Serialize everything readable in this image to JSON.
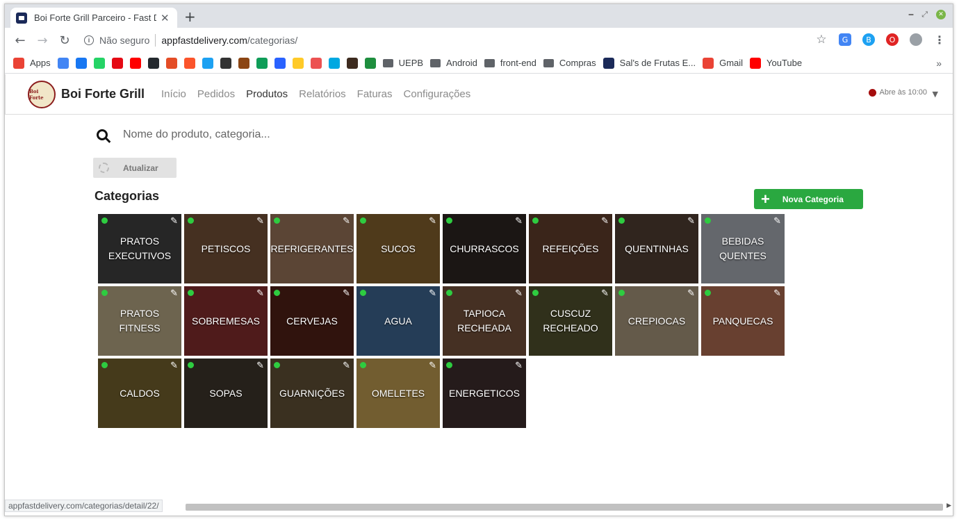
{
  "browser": {
    "tab_title": "Boi Forte Grill Parceiro - Fast De",
    "new_tab": "+",
    "address": {
      "security_label": "Não seguro",
      "host": "appfastdelivery.com",
      "path": "/categorias/"
    },
    "bookmarks": [
      {
        "label": "Apps",
        "icon": "apps-grid-icon",
        "color": "#ea4335"
      },
      {
        "label": "",
        "icon": "gcal-icon",
        "color": "#4285f4"
      },
      {
        "label": "",
        "icon": "facebook-icon",
        "color": "#1877f2"
      },
      {
        "label": "",
        "icon": "whatsapp-icon",
        "color": "#25d366"
      },
      {
        "label": "",
        "icon": "netflix-icon",
        "color": "#e50914"
      },
      {
        "label": "",
        "icon": "youtube-icon",
        "color": "#ff0000"
      },
      {
        "label": "",
        "icon": "github-icon",
        "color": "#24292e"
      },
      {
        "label": "",
        "icon": "ext-icon",
        "color": "#e44d26"
      },
      {
        "label": "",
        "icon": "brave-icon",
        "color": "#fb542b"
      },
      {
        "label": "",
        "icon": "twitter-icon",
        "color": "#1da1f2"
      },
      {
        "label": "",
        "icon": "trello-icon",
        "color": "#333333"
      },
      {
        "label": "",
        "icon": "book-icon",
        "color": "#8b4513"
      },
      {
        "label": "",
        "icon": "drive-icon",
        "color": "#0f9d58"
      },
      {
        "label": "",
        "icon": "ap-icon",
        "color": "#2962ff"
      },
      {
        "label": "",
        "icon": "firebase-icon",
        "color": "#ffca28"
      },
      {
        "label": "",
        "icon": "udemy-icon",
        "color": "#ec5252"
      },
      {
        "label": "",
        "icon": "u-icon",
        "color": "#00a8e1"
      },
      {
        "label": "",
        "icon": "k-icon",
        "color": "#3d2b1f"
      },
      {
        "label": "",
        "icon": "classroom-icon",
        "color": "#1e8e3e"
      }
    ],
    "bookmark_folders": [
      "UEPB",
      "Android",
      "front-end",
      "Compras"
    ],
    "bookmark_links": [
      {
        "label": "Sal's de Frutas E...",
        "color": "#1b2a59"
      },
      {
        "label": "Gmail",
        "color": "#ea4335"
      },
      {
        "label": "YouTube",
        "color": "#ff0000"
      }
    ],
    "bookmarks_more": "»",
    "status_url": "appfastdelivery.com/categorias/detail/22/"
  },
  "app": {
    "logo_text": "Boi Forte",
    "brand": "Boi Forte Grill",
    "menu": [
      "Início",
      "Pedidos",
      "Produtos",
      "Relatórios",
      "Faturas",
      "Configurações"
    ],
    "active_menu": "Produtos",
    "status_text": "Abre às 10:00",
    "status_color": "#a50d0d"
  },
  "search": {
    "placeholder": "Nome do produto, categoria..."
  },
  "refresh_label": "Atualizar",
  "section_title": "Categorias",
  "new_category_label": "Nova Categoria",
  "accent_color": "#2aa840",
  "categories": [
    {
      "name": "PRATOS EXECUTIVOS",
      "bg": "#3b3b3b",
      "active": true
    },
    {
      "name": "PETISCOS",
      "bg": "#6b4a33",
      "active": true
    },
    {
      "name": "REFRIGERANTES",
      "bg": "#8c6a52",
      "active": true
    },
    {
      "name": "SUCOS",
      "bg": "#7a5a2a",
      "active": true
    },
    {
      "name": "CHURRASCOS",
      "bg": "#2a2220",
      "active": true
    },
    {
      "name": "REFEIÇÕES",
      "bg": "#5a3a28",
      "active": true
    },
    {
      "name": "QUENTINHAS",
      "bg": "#4a3a2e",
      "active": true
    },
    {
      "name": "BEBIDAS QUENTES",
      "bg": "#9a9ea6",
      "active": true
    },
    {
      "name": "PRATOS FITNESS",
      "bg": "#a89a7a",
      "active": true
    },
    {
      "name": "SOBREMESAS",
      "bg": "#7a2a2a",
      "active": true
    },
    {
      "name": "CERVEJAS",
      "bg": "#4a1e14",
      "active": true
    },
    {
      "name": "AGUA",
      "bg": "#3a5f86",
      "active": true
    },
    {
      "name": "TAPIOCA RECHEADA",
      "bg": "#6a4a36",
      "active": true
    },
    {
      "name": "CUSCUZ RECHEADO",
      "bg": "#4a4a2a",
      "active": true
    },
    {
      "name": "CREPIOCAS",
      "bg": "#9a8a72",
      "active": true
    },
    {
      "name": "PANQUECAS",
      "bg": "#a0634a",
      "active": true
    },
    {
      "name": "CALDOS",
      "bg": "#6a5a2a",
      "active": true
    },
    {
      "name": "SOPAS",
      "bg": "#3a3228",
      "active": true
    },
    {
      "name": "GUARNIÇÕES",
      "bg": "#5a4a32",
      "active": true
    },
    {
      "name": "OMELETES",
      "bg": "#b0904a",
      "active": true
    },
    {
      "name": "ENERGETICOS",
      "bg": "#3a2a2a",
      "active": true
    }
  ]
}
